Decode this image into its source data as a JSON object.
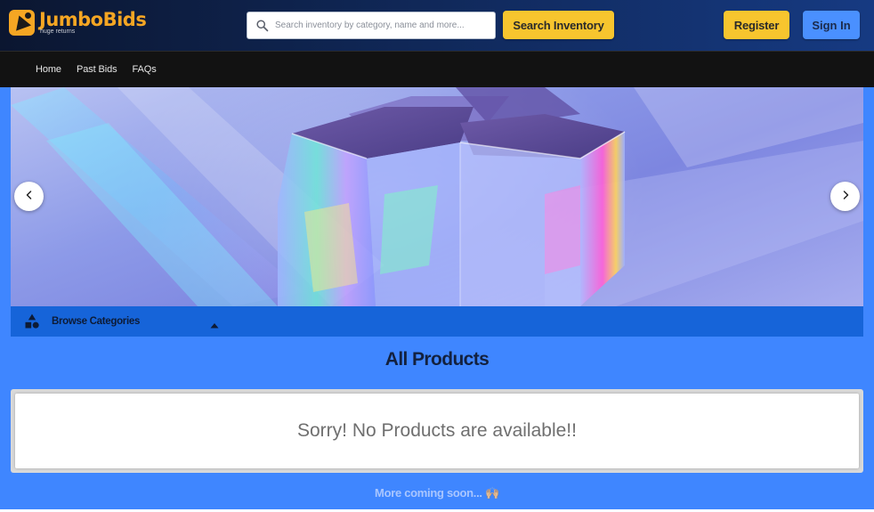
{
  "brand": {
    "name": "JumboBids",
    "tagline": "huge returns",
    "accent": "#f5a623"
  },
  "header": {
    "search_placeholder": "Search inventory by category, name and more...",
    "search_button": "Search Inventory",
    "register_button": "Register",
    "signin_button": "Sign In"
  },
  "nav": {
    "items": [
      {
        "label": "Home"
      },
      {
        "label": "Past Bids"
      },
      {
        "label": "FAQs"
      }
    ]
  },
  "carousel": {
    "prev_icon": "chevron-left-icon",
    "next_icon": "chevron-right-icon"
  },
  "categories": {
    "label": "Browse Categories",
    "icon": "shapes-icon",
    "caret_icon": "caret-up-icon"
  },
  "products": {
    "title": "All Products",
    "empty_message": "Sorry! No Products are available!!"
  },
  "footer": {
    "coming_soon": "More coming soon... 🙌🏼"
  },
  "colors": {
    "page_bg": "#3f86ff",
    "topbar_bg": "#0f2552",
    "navbar_bg": "#121212",
    "category_bar": "#1664d9",
    "button_yellow": "#f7c52e",
    "button_blue": "#4a90ff"
  }
}
